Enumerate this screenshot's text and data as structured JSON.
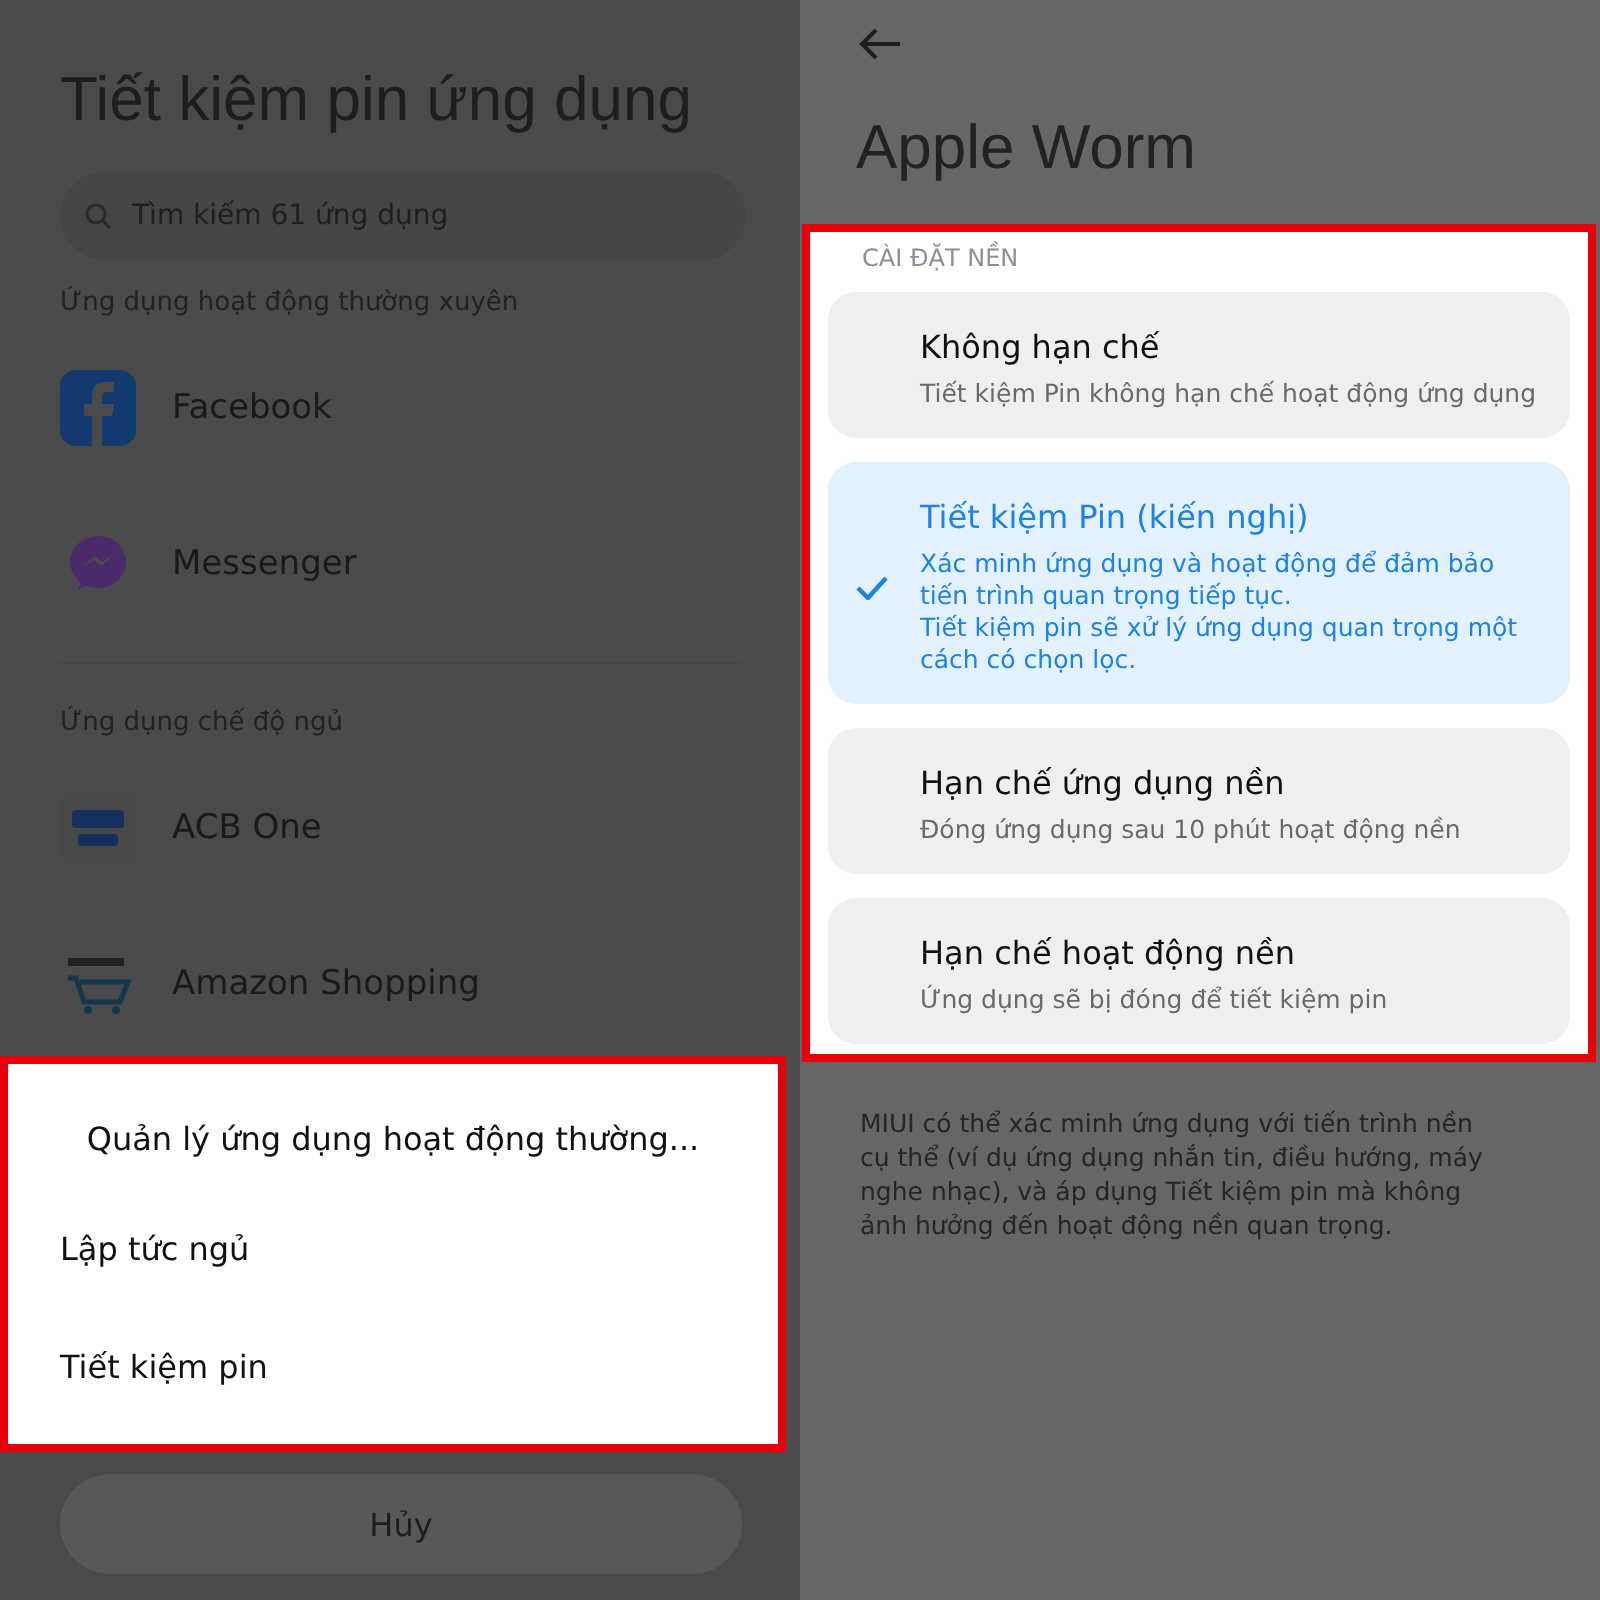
{
  "left_screen": {
    "title": "Tiết kiệm pin ứng dụng",
    "search": {
      "placeholder": "Tìm kiếm 61 ứng dụng"
    },
    "sections": [
      {
        "label": "Ứng dụng hoạt động thường xuyên",
        "apps": [
          {
            "name": "Facebook",
            "kind": "facebook"
          },
          {
            "name": "Messenger",
            "kind": "messenger"
          }
        ]
      },
      {
        "label": "Ứng dụng chế độ ngủ",
        "apps": [
          {
            "name": "ACB One",
            "kind": "acb"
          },
          {
            "name": "Amazon Shopping",
            "kind": "amazon"
          }
        ]
      }
    ],
    "sheet": {
      "title": "Quản lý ứng dụng hoạt động thường...",
      "options": [
        "Lập tức ngủ",
        "Tiết kiệm pin"
      ],
      "cancel": "Hủy"
    }
  },
  "right_screen": {
    "title": "Apple Worm",
    "section_label": "CÀI ĐẶT NỀN",
    "options": [
      {
        "title": "Không hạn chế",
        "description": "Tiết kiệm Pin không hạn chế hoạt động ứng dụng",
        "selected": false
      },
      {
        "title": "Tiết kiệm Pin (kiến nghị)",
        "description": "Xác minh ứng dụng và hoạt động để đảm bảo tiến trình quan trọng tiếp tục.\nTiết kiệm pin sẽ xử lý ứng dụng quan trọng một cách có chọn lọc.",
        "selected": true
      },
      {
        "title": "Hạn chế ứng dụng nền",
        "description": "Đóng ứng dụng sau 10 phút hoạt động nền",
        "selected": false
      },
      {
        "title": "Hạn chế hoạt động nền",
        "description": "Ứng dụng sẽ bị đóng để tiết kiệm pin",
        "selected": false
      }
    ],
    "footer": "MIUI có thể xác minh ứng dụng với tiến trình nền cụ thể (ví dụ ứng dụng nhắn tin, điều hướng, máy nghe nhạc), và áp dụng Tiết kiệm pin mà không ảnh hưởng đến hoạt động nền quan trọng."
  }
}
